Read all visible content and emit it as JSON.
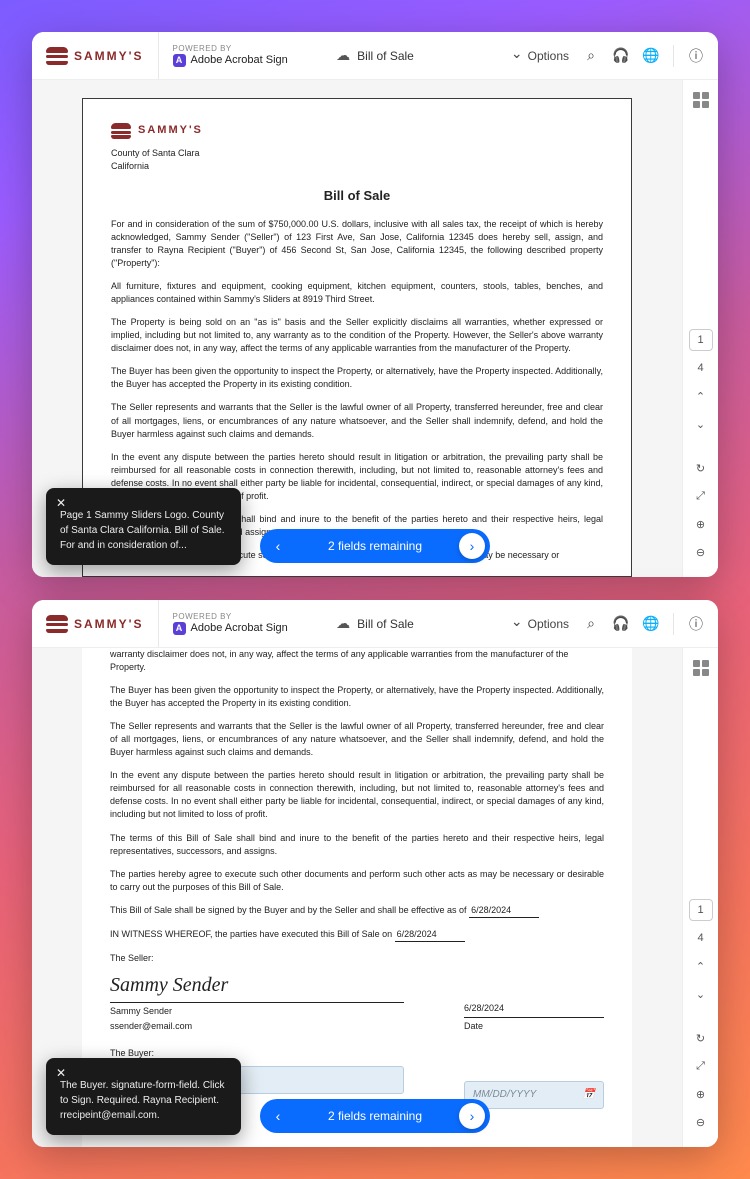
{
  "brand": {
    "name": "SAMMY'S"
  },
  "powered": {
    "label": "POWERED BY",
    "product": "Adobe Acrobat Sign",
    "badge": "A"
  },
  "docTitle": "Bill of Sale",
  "options": "Options",
  "rail": {
    "page": "1",
    "pages": "4"
  },
  "doc": {
    "county": "County of Santa Clara",
    "state": "California",
    "title": "Bill of Sale",
    "p1": "For and in consideration of the sum of $750,000.00 U.S. dollars, inclusive with all sales tax, the receipt of which is hereby acknowledged, Sammy Sender (\"Seller\") of 123 First Ave, San Jose, California 12345 does hereby sell, assign, and transfer to Rayna Recipient (\"Buyer\") of 456 Second St, San Jose, California 12345, the following described property (\"Property\"):",
    "p2": "All furniture, fixtures and equipment, cooking equipment, kitchen equipment, counters, stools, tables, benches, and appliances contained within Sammy's Sliders at 8919 Third Street.",
    "p3": "The Property is being sold on an \"as is\" basis and the Seller explicitly disclaims all warranties, whether expressed or implied, including but not limited to, any warranty as to the condition of the Property. However, the Seller's above warranty disclaimer does not, in any way, affect the terms of any applicable warranties from the manufacturer of the Property.",
    "p4": "The Buyer has been given the opportunity to inspect the Property, or alternatively, have the Property inspected. Additionally, the Buyer has accepted the Property in its existing condition.",
    "p5": "The Seller represents and warrants that the Seller is the lawful owner of all Property, transferred hereunder, free and clear of all mortgages, liens, or encumbrances of any nature whatsoever, and the Seller shall indemnify, defend, and hold the Buyer harmless against such claims and demands.",
    "p6": "In the event any dispute between the parties hereto should result in litigation or arbitration, the prevailing party shall be reimbursed for all reasonable costs in connection therewith, including, but not limited to, reasonable attorney's fees and defense costs. In no event shall either party be liable for incidental, consequential, indirect, or special damages of any kind, including but not limited to loss of profit.",
    "p7": "The terms of this Bill of Sale shall bind and inure to the benefit of the parties hereto and their respective heirs, legal representatives, successors, and assigns.",
    "p8frag": "to execute such other documents and perform such other acts as may be necessary or",
    "p9frag": "igned by the Buyer and by the Seller and shall be effective as of",
    "effDate": "6/28/2024",
    "p3tail": "warranty disclaimer does not, in any way, affect the terms of any applicable warranties from the manufacturer of the Property.",
    "p8": "The parties hereby agree to execute such other documents and perform such other acts as may be necessary or desirable to carry out the purposes of this Bill of Sale.",
    "p9a": "This Bill of Sale shall be signed by the Buyer and by the Seller and shall be effective as of",
    "p10a": "IN WITNESS WHEREOF, the parties have executed this Bill of Sale on",
    "witnessDate": "6/28/2024",
    "sellerLabel": "The Seller:",
    "sellerSig": "Sammy Sender",
    "sellerName": "Sammy Sender",
    "sellerEmail": "ssender@email.com",
    "sellerDate": "6/28/2024",
    "dateLabel": "Date",
    "buyerLabel": "The Buyer:",
    "buyerName": "Rayna Recipient",
    "buyerEmail": "rrecipient@email.com",
    "signPrompt": "Click to Sign",
    "datePlaceholder": "MM/DD/YYYY"
  },
  "tooltip1": "Page 1 Sammy Sliders Logo. County of Santa Clara California. Bill of Sale. For and in consideration of...",
  "tooltip2": "The Buyer. signature-form-field. Click to Sign. Required. Rayna Recipient. rrecipeint@email.com.",
  "pill": "2 fields remaining"
}
